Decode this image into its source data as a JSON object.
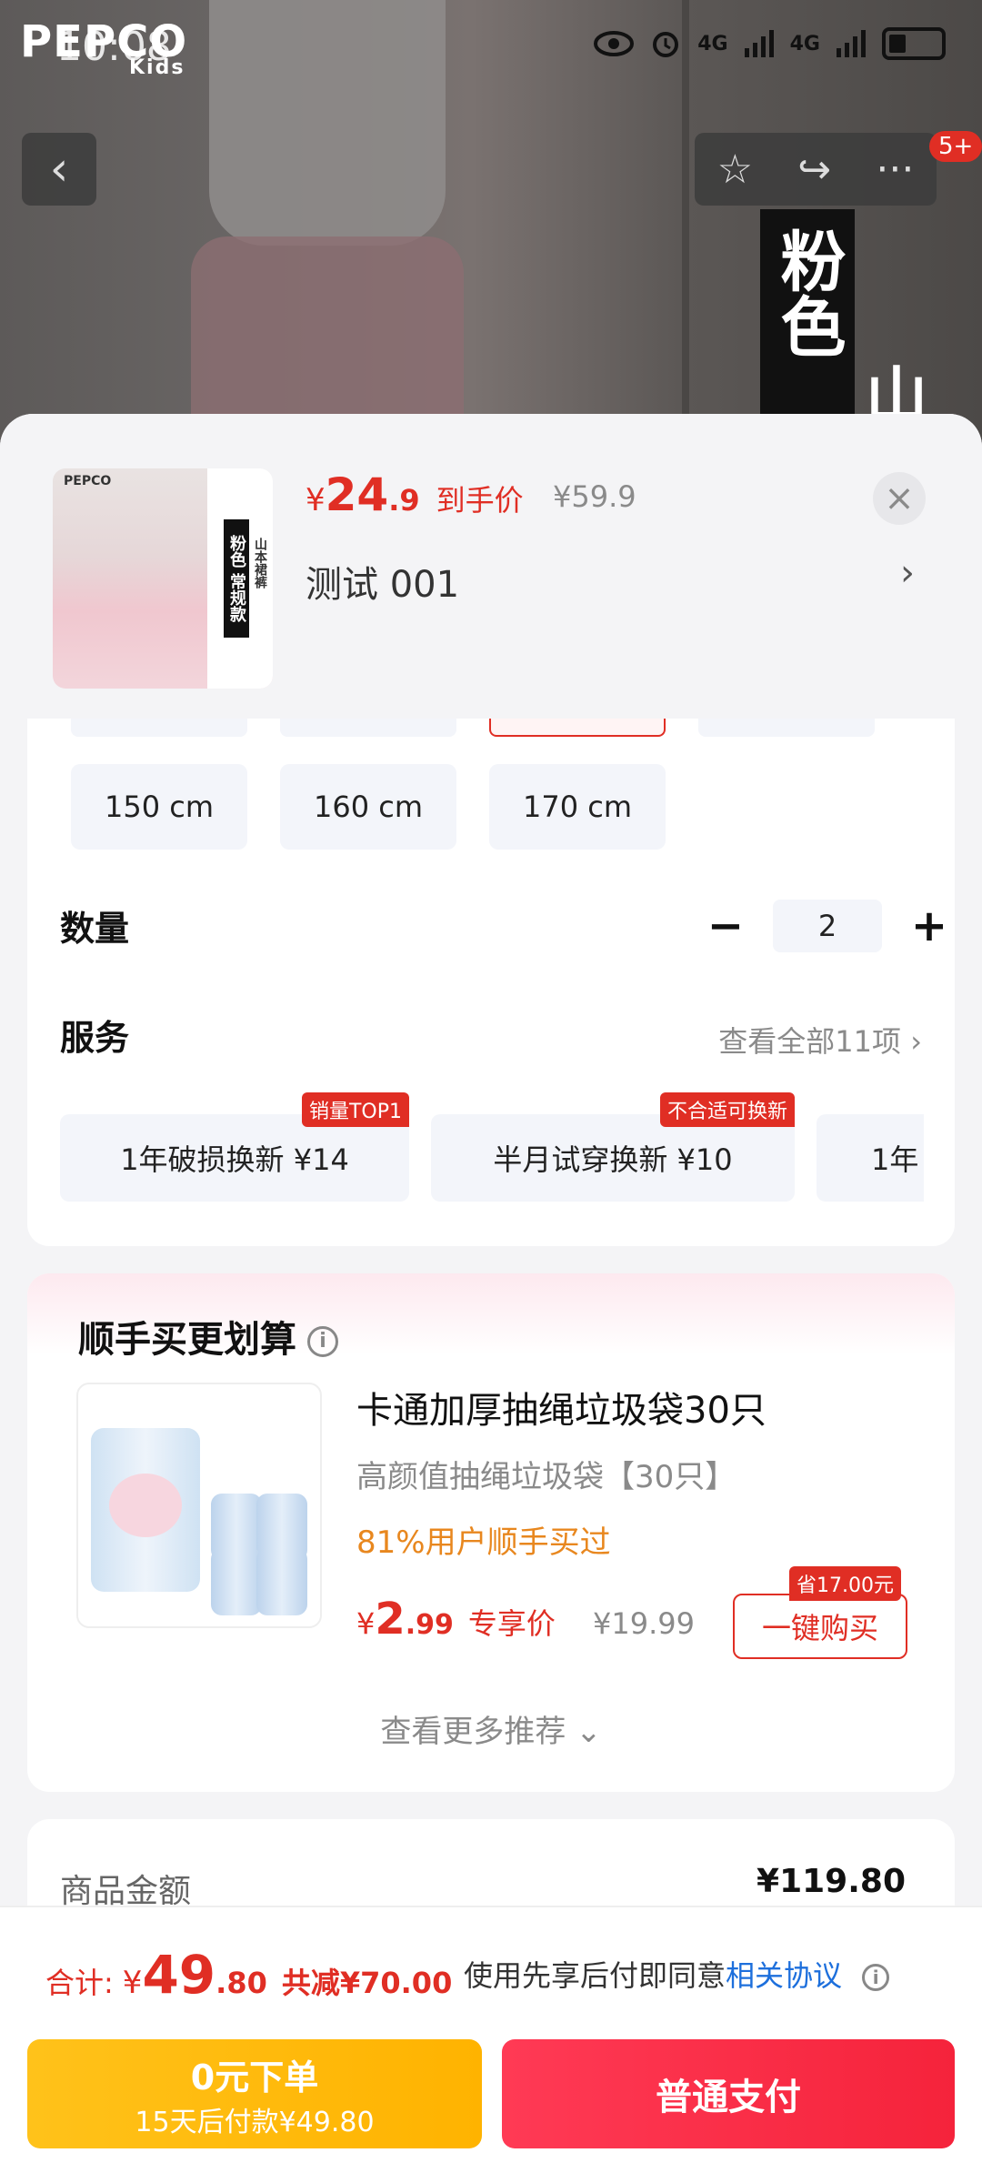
{
  "status_bar": {
    "time": "10:08",
    "net1": "4G",
    "net2": "4G"
  },
  "hero": {
    "brand": "PEPCO",
    "brand_sub": "Kids",
    "banner_text": "粉色",
    "banner_side": "山",
    "cart_badge": "5+"
  },
  "sku_header": {
    "thumb_brand": "PEPCO",
    "thumb_tag": "粉色 常规款",
    "thumb_side": "山本裙裤",
    "price_currency": "¥",
    "price_int": "24",
    "price_dec": ".9",
    "price_label": "到手价",
    "original_price": "¥59.9",
    "close_icon": "×",
    "sku_name": "测试  001",
    "arrow": "›"
  },
  "sizes": [
    "150 cm",
    "160 cm",
    "170 cm"
  ],
  "quantity": {
    "label": "数量",
    "minus": "−",
    "value": "2",
    "plus": "+"
  },
  "services": {
    "label": "服务",
    "see_all": "查看全部11项 ›",
    "items": [
      {
        "name": "1年破损换新  ¥14",
        "tag": "销量TOP1"
      },
      {
        "name": "半月试穿换新  ¥10",
        "tag": "不合适可换新"
      },
      {
        "name": "1年",
        "tag": ""
      }
    ]
  },
  "addon": {
    "title": "顺手买更划算",
    "info_icon": "i",
    "product_title": "卡通加厚抽绳垃圾袋30只",
    "product_sub": "高颜值抽绳垃圾袋【30只】",
    "buy_rate": "81%用户顺手买过",
    "price_currency": "¥",
    "price_int": "2",
    "price_dec": ".99",
    "price_label": "专享价",
    "original_price": "¥19.99",
    "save_tag": "省17.00元",
    "buy_button": "一键购买",
    "see_more": "查看更多推荐 ⌄"
  },
  "summary": {
    "label": "商品金额",
    "value": "¥119.80"
  },
  "footer": {
    "total_label": "合计:",
    "total_currency": "¥",
    "total_int": "49",
    "total_dec": ".80",
    "total_reduce": "共减¥70.00",
    "agree_text": "使用先享后付即同意",
    "agree_link": "相关协议",
    "info_icon": "i",
    "btn_later_line1": "0元下单",
    "btn_later_line2": "15天后付款¥49.80",
    "btn_pay": "普通支付"
  }
}
